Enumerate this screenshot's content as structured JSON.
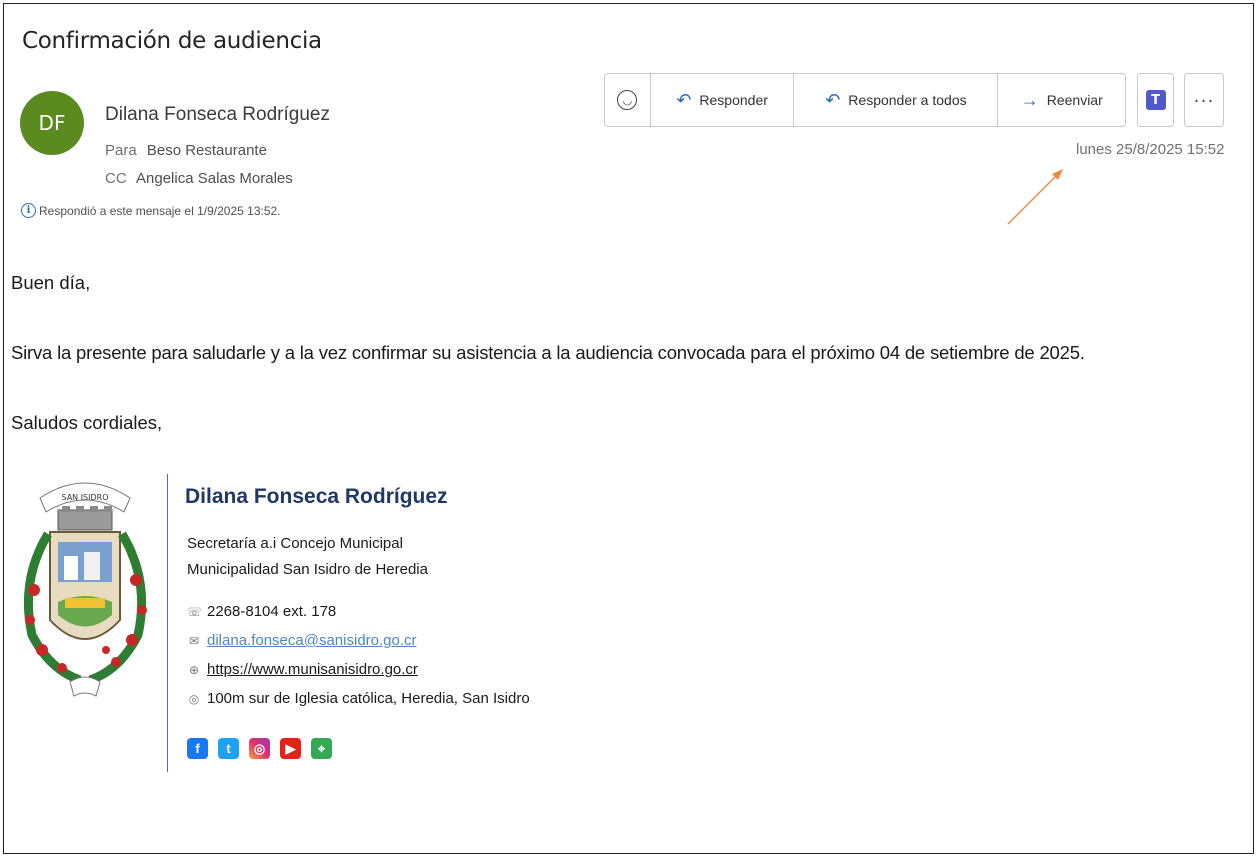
{
  "email": {
    "subject": "Confirmación de audiencia",
    "sender": {
      "initials": "DF",
      "name": "Dilana Fonseca Rodríguez",
      "avatar_color": "#5b8a1e"
    },
    "to": {
      "label": "Para",
      "value": "Beso Restaurante"
    },
    "cc": {
      "label": "CC",
      "value": "Angelica Salas Morales"
    },
    "info_message": "Respondió a este mensaje el 1/9/2025 13:52.",
    "date": "lunes 25/8/2025 15:52"
  },
  "toolbar": {
    "emoji_icon": "smiley-icon",
    "reply_label": "Responder",
    "reply_all_label": "Responder a todos",
    "forward_label": "Reenviar",
    "teams_icon": "teams-icon",
    "more_label": "···"
  },
  "body": {
    "greeting": "Buen día,",
    "paragraph": "Sirva la presente para saludarle y a la vez confirmar su asistencia a la audiencia convocada para el próximo 04 de setiembre de 2025.",
    "closing": "Saludos cordiales,"
  },
  "signature": {
    "name": "Dilana Fonseca Rodríguez",
    "role": "Secretaría a.i Concejo Municipal",
    "organization": "Municipalidad San Isidro de Heredia",
    "phone": "2268-8104 ext. 178",
    "email": "dilana.fonseca@sanisidro.go.cr",
    "website": "https://www.munisanisidro.go.cr",
    "address": "100m sur de Iglesia católica, Heredia, San Isidro",
    "crest_banner_text": "SAN ISIDRO",
    "name_color": "#1f3864",
    "socials": [
      "facebook-icon",
      "twitter-icon",
      "instagram-icon",
      "youtube-icon",
      "maps-icon"
    ]
  },
  "annotation": {
    "arrow_color": "#f0883e"
  }
}
